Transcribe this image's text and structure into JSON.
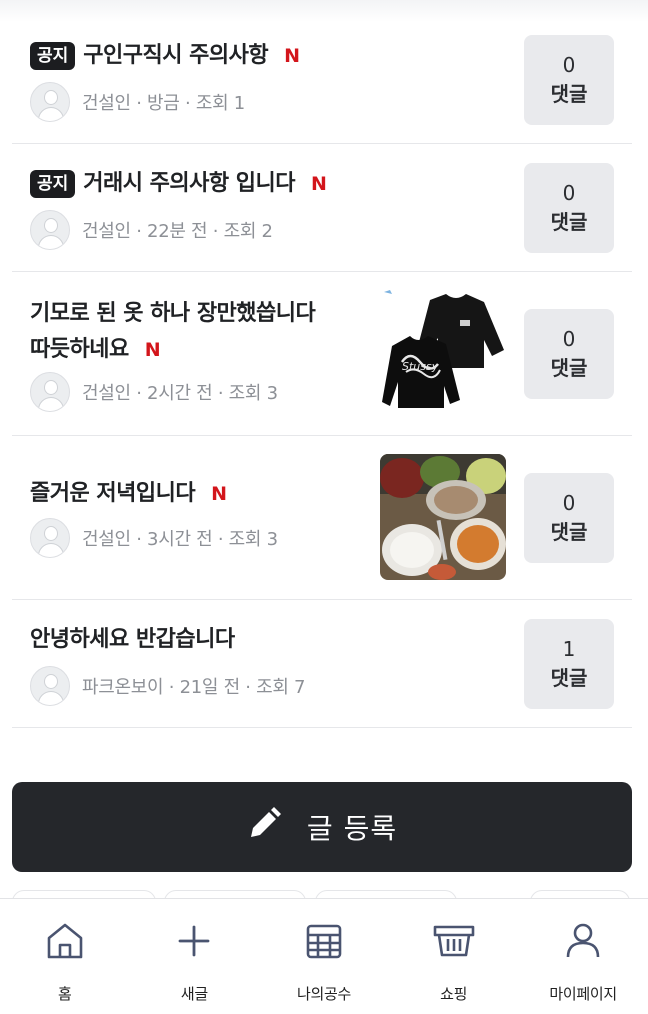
{
  "posts": [
    {
      "notice": "공지",
      "title": "구인구직시 주의사항",
      "new": "N",
      "author": "건설인",
      "time": "방금",
      "views": "조회 1",
      "comments": "0",
      "comment_label": "댓글"
    },
    {
      "notice": "공지",
      "title": "거래시 주의사항 입니다",
      "new": "N",
      "author": "건설인",
      "time": "22분 전",
      "views": "조회 2",
      "comments": "0",
      "comment_label": "댓글"
    },
    {
      "title_line1": "기모로 된 옷 하나 장만했씁니다",
      "title_line2": "따듯하네요",
      "new": "N",
      "author": "건설인",
      "time": "2시간 전",
      "views": "조회 3",
      "comments": "0",
      "comment_label": "댓글",
      "thumbnail": "black-sweatshirt-photo",
      "thumbnail_print": "Stussy"
    },
    {
      "title": "즐거운 저녁입니다",
      "new": "N",
      "author": "건설인",
      "time": "3시간 전",
      "views": "조회 3",
      "comments": "0",
      "comment_label": "댓글",
      "thumbnail": "dinner-food-photo"
    },
    {
      "title": "안녕하세요 반갑습니다",
      "author": "파크온보이",
      "time": "21일 전",
      "views": "조회 7",
      "comments": "1",
      "comment_label": "댓글"
    }
  ],
  "separator": "·",
  "write_button": {
    "label": "글 등록",
    "icon": "pencil-icon"
  },
  "nav": [
    {
      "label": "홈",
      "icon": "home-icon"
    },
    {
      "label": "새글",
      "icon": "plus-icon"
    },
    {
      "label": "나의공수",
      "icon": "calendar-icon"
    },
    {
      "label": "쇼핑",
      "icon": "basket-icon"
    },
    {
      "label": "마이페이지",
      "icon": "user-icon"
    }
  ],
  "colors": {
    "new_mark": "#d3151b",
    "button_bg": "#25272b",
    "badge_bg": "#1c1d20",
    "comment_box_bg": "#e9eaed"
  }
}
